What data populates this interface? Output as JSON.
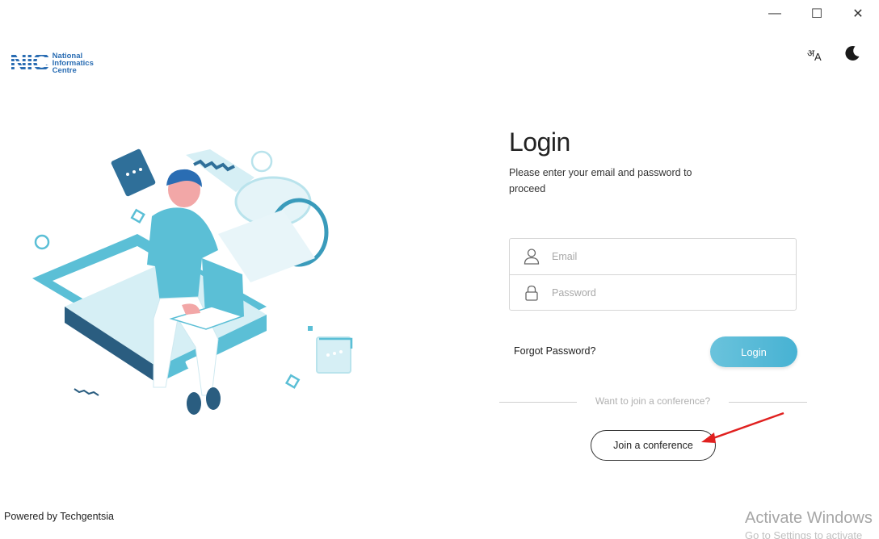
{
  "window": {
    "minimize_glyph": "—",
    "maximize_glyph": "☐",
    "close_glyph": "✕"
  },
  "logo": {
    "mark": "NIC",
    "line1": "National",
    "line2": "Informatics",
    "line3": "Centre"
  },
  "header": {
    "language_icon": "translate-icon",
    "language_glyph_1": "अ",
    "language_glyph_2": "A",
    "theme_icon": "moon-icon"
  },
  "login": {
    "title": "Login",
    "subtitle": "Please enter your email and password to proceed",
    "email_placeholder": "Email",
    "email_value": "",
    "password_placeholder": "Password",
    "password_value": "",
    "forgot_label": "Forgot Password?",
    "login_button": "Login",
    "divider_text": "Want to join a conference?",
    "join_button": "Join a conference"
  },
  "footer": {
    "powered_by": "Powered by Techgentsia"
  },
  "watermark": {
    "title": "Activate Windows",
    "subtitle": "Go to Settings to activate"
  },
  "colors": {
    "accent": "#4db5d5",
    "logo_blue": "#2a6db3",
    "annotation_arrow": "#e0201f"
  }
}
